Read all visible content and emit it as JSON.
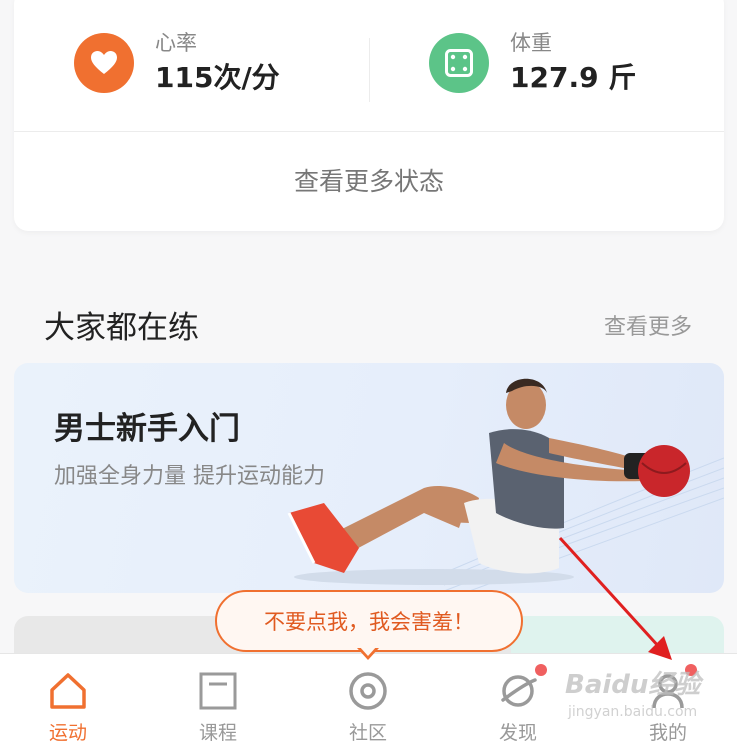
{
  "stats": {
    "heart": {
      "label": "心率",
      "value": "115次/分",
      "icon": "heart-icon",
      "color": "#f07030"
    },
    "weight": {
      "label": "体重",
      "value": "127.9 斤",
      "icon": "scale-icon",
      "color": "#5cc488"
    },
    "more_label": "查看更多状态"
  },
  "section": {
    "title": "大家都在练",
    "more_label": "查看更多"
  },
  "course": {
    "title": "男士新手入门",
    "subtitle": "加强全身力量 提升运动能力"
  },
  "tooltip": {
    "text": "不要点我，我会害羞！"
  },
  "tabs": [
    {
      "label": "运动",
      "icon": "home-icon",
      "active": true
    },
    {
      "label": "课程",
      "icon": "course-icon",
      "active": false
    },
    {
      "label": "社区",
      "icon": "community-icon",
      "active": false
    },
    {
      "label": "发现",
      "icon": "discover-icon",
      "active": false,
      "badge": true
    },
    {
      "label": "我的",
      "icon": "profile-icon",
      "active": false,
      "badge": true
    }
  ],
  "colors": {
    "accent": "#f07030",
    "badge": "#f06060"
  },
  "watermark": {
    "brand": "Baidu经验",
    "url": "jingyan.baidu.com"
  }
}
